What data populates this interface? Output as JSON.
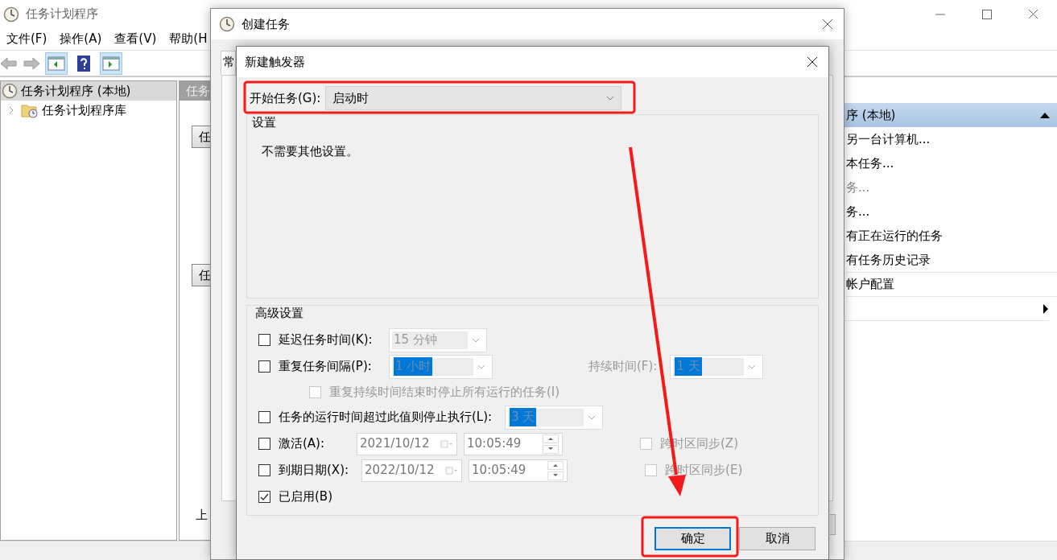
{
  "main_window": {
    "title": "任务计划程序",
    "menu": [
      "文件(F)",
      "操作(A)",
      "查看(V)",
      "帮助(H"
    ],
    "tree": [
      {
        "label": "任务计划程序 (本地)",
        "selected": true,
        "children": [
          {
            "label": "任务计划程序库",
            "selected": false
          }
        ]
      }
    ],
    "center_pane": {
      "header": "任务",
      "buttons": [
        "任",
        "任"
      ],
      "footer": "上"
    },
    "actions_pane": {
      "header": "序 (本地)",
      "items": [
        {
          "kind": "action",
          "label": "另一台计算机...",
          "disabled": false
        },
        {
          "kind": "action",
          "label": "本任务...",
          "disabled": false
        },
        {
          "kind": "action",
          "label": "务...",
          "disabled": true
        },
        {
          "kind": "action",
          "label": "务...",
          "disabled": false
        },
        {
          "kind": "action",
          "label": "有正在运行的任务",
          "disabled": false
        },
        {
          "kind": "action",
          "label": "有任务历史记录",
          "disabled": false
        },
        {
          "kind": "action",
          "label": "帐户配置",
          "disabled": false
        },
        {
          "kind": "submenu"
        }
      ]
    }
  },
  "create_task_dialog": {
    "title": "创建任务",
    "tabs": [
      {
        "label": "常",
        "selected": true
      }
    ]
  },
  "trigger_dialog": {
    "title": "新建触发器",
    "begin_label": "开始任务(G):",
    "begin_value": "启动时",
    "settings_group": {
      "title": "设置",
      "text": "不需要其他设置。"
    },
    "advanced_group": {
      "title": "高级设置",
      "rows": [
        {
          "kind": "combo",
          "checked": false,
          "label": "延迟任务时间(K):",
          "value": "15 分钟",
          "highlighted": false
        },
        {
          "kind": "combo",
          "checked": false,
          "label": "重复任务间隔(P):",
          "value": "1 小时",
          "highlighted": true,
          "extra_label": "持续时间(F):",
          "extra_value": "1 天",
          "extra_highlighted": true,
          "children": [
            {
              "kind": "check",
              "checked": false,
              "disabled": true,
              "label": "重复持续时间结束时停止所有运行的任务(I)"
            }
          ]
        },
        {
          "kind": "combo",
          "checked": false,
          "label": "任务的运行时间超过此值则停止执行(L):",
          "value": "3 天",
          "highlighted": true
        },
        {
          "kind": "datetime",
          "checked": false,
          "label": "激活(A):",
          "date": "2021/10/12",
          "time": "10:05:49",
          "sync_label": "跨时区同步(Z)",
          "sync_checked": false
        },
        {
          "kind": "datetime",
          "checked": false,
          "label": "到期日期(X):",
          "date": "2022/10/12",
          "time": "10:05:49",
          "sync_label": "跨时区同步(E)",
          "sync_checked": false
        },
        {
          "kind": "check",
          "checked": true,
          "disabled": false,
          "label": "已启用(B)"
        }
      ]
    },
    "buttons": [
      {
        "label": "确定",
        "default": true
      },
      {
        "label": "取消",
        "default": false
      }
    ]
  }
}
